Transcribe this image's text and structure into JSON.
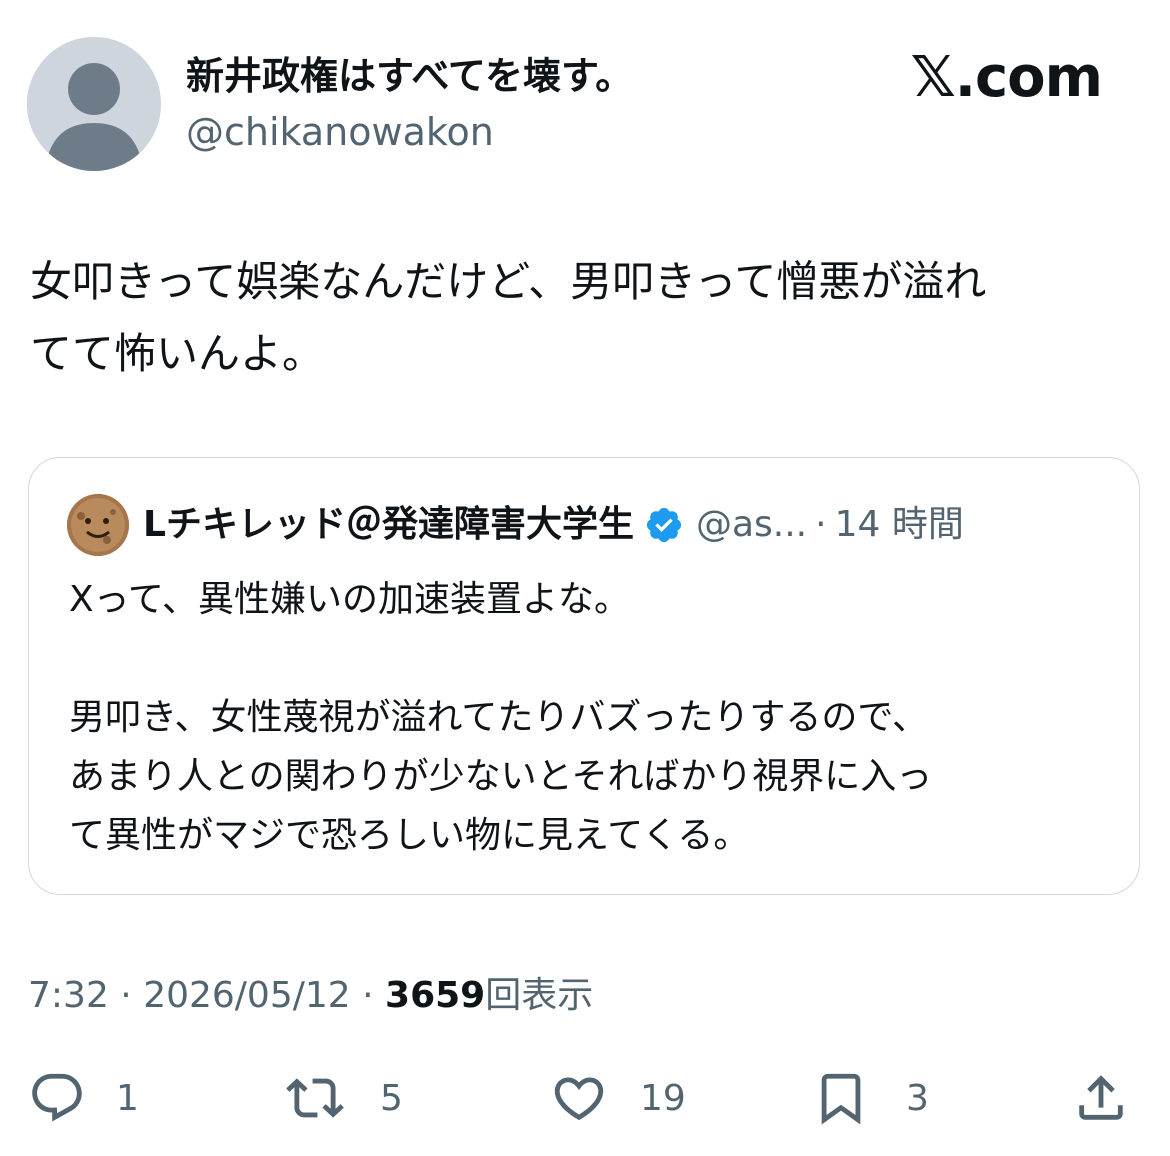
{
  "author": {
    "display_name": "新井政権はすべてを壊す。",
    "handle": "@chikanowakon",
    "avatar_icon": "default-user-icon"
  },
  "brand": {
    "label": "𝕏.com"
  },
  "tweet": {
    "text": "女叩きって娯楽なんだけど、男叩きって憎悪が溢れ\nてて怖いんよ。"
  },
  "quote": {
    "display_name": "Lチキレッド＠発達障害大学生",
    "handle": "@as...",
    "separator": "·",
    "time": "14 時間",
    "verified_icon": "verified-badge-icon",
    "text": "Xって、異性嫌いの加速装置よな。\n\n男叩き、女性蔑視が溢れてたりバズったりするので、\nあまり人との関わりが少ないとそればかり視界に入っ\nて異性がマジで恐ろしい物に見えてくる。"
  },
  "meta": {
    "time": "7:32",
    "sep1": " · ",
    "date": "2026/05/12",
    "sep2": " · ",
    "views_count": "3659",
    "views_label": "回表示"
  },
  "actions": {
    "reply": {
      "icon": "reply-icon",
      "count": "1"
    },
    "repost": {
      "icon": "repost-icon",
      "count": "5"
    },
    "like": {
      "icon": "heart-icon",
      "count": "19"
    },
    "bookmark": {
      "icon": "bookmark-icon",
      "count": "3"
    },
    "share": {
      "icon": "share-icon"
    }
  },
  "colors": {
    "text": "#0f1419",
    "secondary": "#536471",
    "border": "#cfd9de",
    "verified": "#1d9bf0",
    "avatar_bg": "#ced5dc"
  }
}
